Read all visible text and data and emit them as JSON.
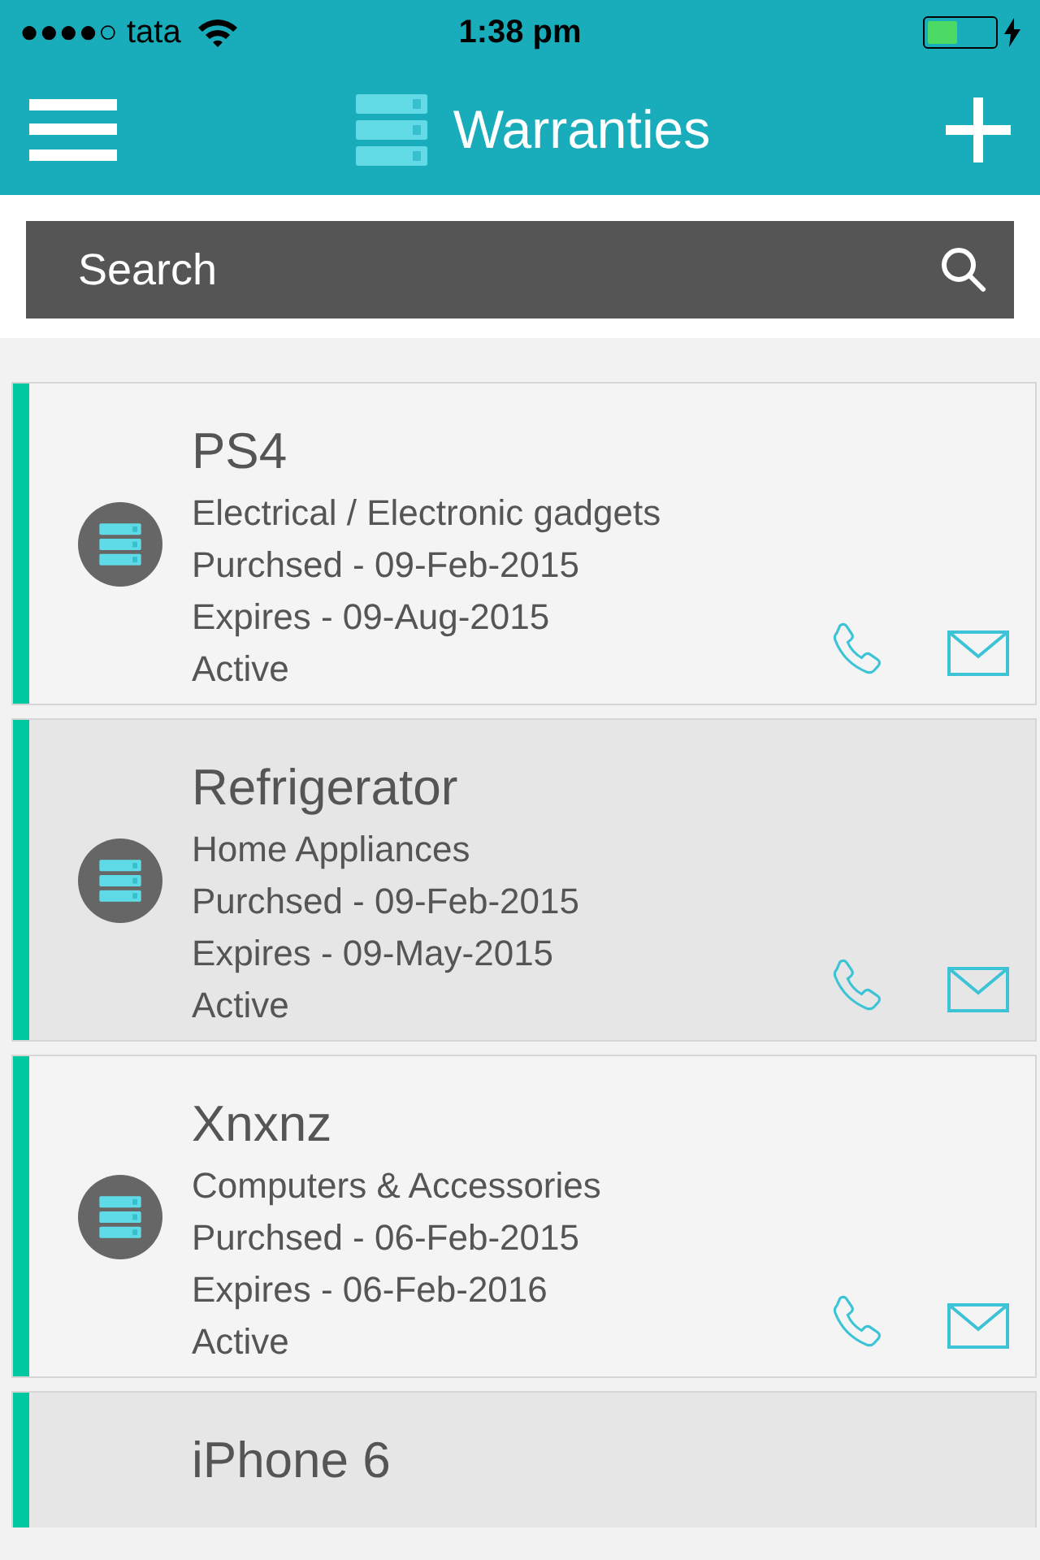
{
  "status_bar": {
    "carrier": "●●●●○ tata",
    "time": "1:38 pm"
  },
  "nav_bar": {
    "title": "Warranties"
  },
  "search": {
    "placeholder": "Search"
  },
  "warranties": [
    {
      "name": "PS4",
      "category": "Electrical / Electronic gadgets",
      "purchased": "Purchsed - 09-Feb-2015",
      "expires": "Expires - 09-Aug-2015",
      "status": "Active"
    },
    {
      "name": "Refrigerator",
      "category": "Home Appliances",
      "purchased": "Purchsed - 09-Feb-2015",
      "expires": "Expires - 09-May-2015",
      "status": "Active"
    },
    {
      "name": "Xnxnz",
      "category": "Computers & Accessories",
      "purchased": "Purchsed - 06-Feb-2015",
      "expires": "Expires - 06-Feb-2016",
      "status": "Active"
    },
    {
      "name": "iPhone 6"
    }
  ]
}
